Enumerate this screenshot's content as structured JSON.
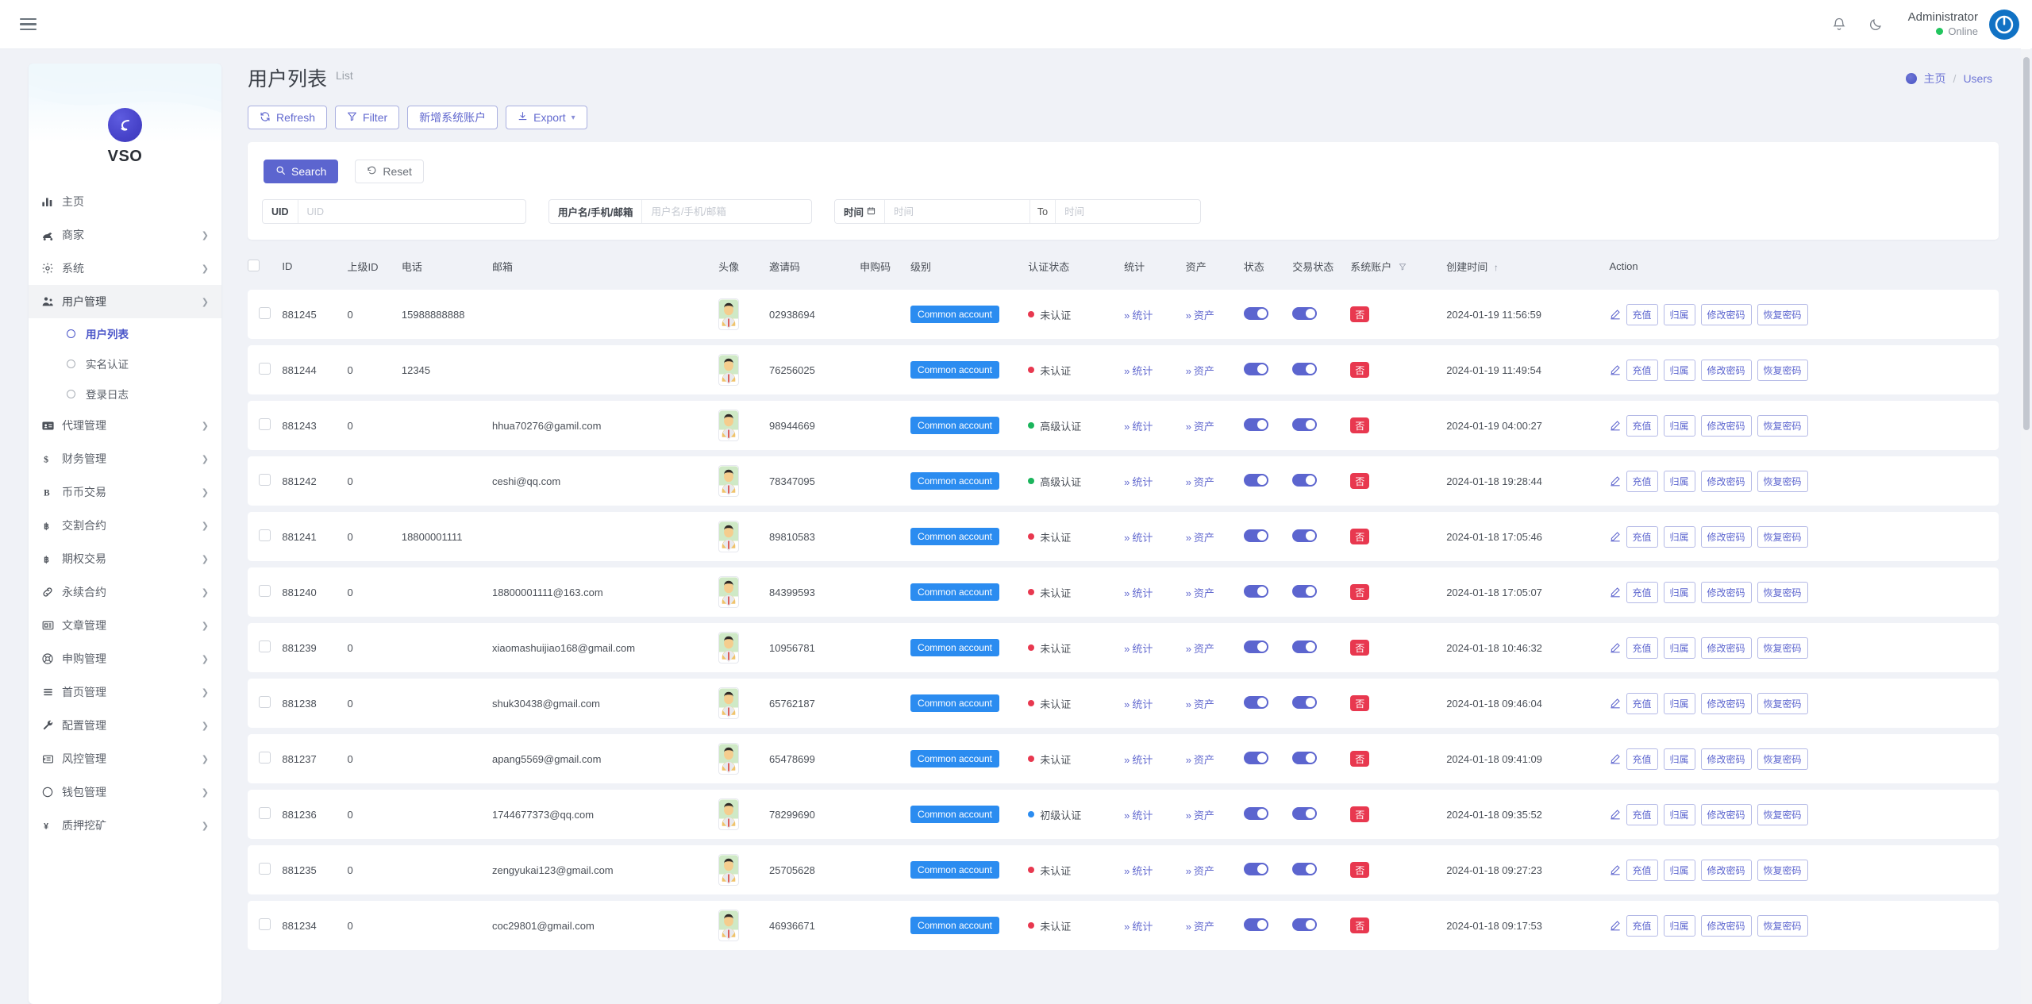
{
  "topbar": {
    "menu_icon": "hamburger-icon",
    "bell_icon": "bell-icon",
    "moon_icon": "moon-icon",
    "user_name": "Administrator",
    "user_status": "Online",
    "avatar_icon": "power-avatar-icon"
  },
  "sidebar": {
    "brand": "VSO",
    "items": [
      {
        "label": "主页",
        "icon": "bar-chart-icon",
        "expandable": false,
        "active": false
      },
      {
        "label": "商家",
        "icon": "merchant-icon",
        "expandable": true,
        "active": false
      },
      {
        "label": "系统",
        "icon": "gear-icon",
        "expandable": true,
        "active": false
      },
      {
        "label": "用户管理",
        "icon": "users-icon",
        "expandable": true,
        "active": true,
        "children": [
          {
            "label": "用户列表",
            "selected": true
          },
          {
            "label": "实名认证",
            "selected": false
          },
          {
            "label": "登录日志",
            "selected": false
          }
        ]
      },
      {
        "label": "代理管理",
        "icon": "id-card-icon",
        "expandable": true,
        "active": false
      },
      {
        "label": "财务管理",
        "icon": "dollar-icon",
        "expandable": true,
        "active": false
      },
      {
        "label": "币币交易",
        "icon": "b-icon",
        "expandable": true,
        "active": false
      },
      {
        "label": "交割合约",
        "icon": "bitcoin-icon",
        "expandable": true,
        "active": false
      },
      {
        "label": "期权交易",
        "icon": "bitcoin-icon",
        "expandable": true,
        "active": false
      },
      {
        "label": "永续合约",
        "icon": "link-icon",
        "expandable": true,
        "active": false
      },
      {
        "label": "文章管理",
        "icon": "newspaper-icon",
        "expandable": true,
        "active": false
      },
      {
        "label": "申购管理",
        "icon": "lifebuoy-icon",
        "expandable": true,
        "active": false
      },
      {
        "label": "首页管理",
        "icon": "list-icon",
        "expandable": true,
        "active": false
      },
      {
        "label": "配置管理",
        "icon": "wrench-icon",
        "expandable": true,
        "active": false
      },
      {
        "label": "风控管理",
        "icon": "indent-icon",
        "expandable": true,
        "active": false
      },
      {
        "label": "钱包管理",
        "icon": "circle-icon",
        "expandable": true,
        "active": false
      },
      {
        "label": "质押挖矿",
        "icon": "yen-icon",
        "expandable": true,
        "active": false
      }
    ]
  },
  "page": {
    "title": "用户列表",
    "subtitle": "List",
    "breadcrumb_home": "主页",
    "breadcrumb_sep": "/",
    "breadcrumb_current": "Users"
  },
  "toolbar": {
    "refresh_label": "Refresh",
    "filter_label": "Filter",
    "add_system_account_label": "新增系统账户",
    "export_label": "Export"
  },
  "search": {
    "search_label": "Search",
    "reset_label": "Reset",
    "uid_label": "UID",
    "uid_placeholder": "UID",
    "uid_value": "",
    "user_label": "用户名/手机/邮箱",
    "user_placeholder": "用户名/手机/邮箱",
    "user_value": "",
    "time_label": "时间",
    "time_from_placeholder": "时间",
    "time_from_value": "",
    "to_label": "To",
    "time_to_placeholder": "时间",
    "time_to_value": ""
  },
  "table": {
    "columns": [
      "ID",
      "上级ID",
      "电话",
      "邮箱",
      "头像",
      "邀请码",
      "申购码",
      "级别",
      "认证状态",
      "统计",
      "资产",
      "状态",
      "交易状态",
      "系统账户",
      "创建时间",
      "Action"
    ],
    "sort_column": "创建时间",
    "sort_dir": "↑",
    "filter_column": "系统账户",
    "links": {
      "stats": "统计",
      "assets": "资产"
    },
    "actions": {
      "edit_icon": "pencil-icon",
      "recharge": "充值",
      "attribution": "归属",
      "change_password": "修改密码",
      "restore_password": "恢复密码"
    },
    "system_account_no": "否",
    "level_tag": "Common account",
    "cert_colors": {
      "未认证": "#e8384f",
      "初级认证": "#2b8cf0",
      "高级认证": "#1bb55c"
    },
    "rows": [
      {
        "id": "881245",
        "parent_id": "0",
        "phone": "15988888888",
        "email": "",
        "invite": "02938694",
        "purchase": "",
        "level": "Common account",
        "cert": "未认证",
        "status_on": true,
        "trade_on": true,
        "system": "否",
        "created": "2024-01-19 11:56:59"
      },
      {
        "id": "881244",
        "parent_id": "0",
        "phone": "12345",
        "email": "",
        "invite": "76256025",
        "purchase": "",
        "level": "Common account",
        "cert": "未认证",
        "status_on": true,
        "trade_on": true,
        "system": "否",
        "created": "2024-01-19 11:49:54"
      },
      {
        "id": "881243",
        "parent_id": "0",
        "phone": "",
        "email": "hhua70276@gamil.com",
        "invite": "98944669",
        "purchase": "",
        "level": "Common account",
        "cert": "高级认证",
        "status_on": true,
        "trade_on": true,
        "system": "否",
        "created": "2024-01-19 04:00:27"
      },
      {
        "id": "881242",
        "parent_id": "0",
        "phone": "",
        "email": "ceshi@qq.com",
        "invite": "78347095",
        "purchase": "",
        "level": "Common account",
        "cert": "高级认证",
        "status_on": true,
        "trade_on": true,
        "system": "否",
        "created": "2024-01-18 19:28:44"
      },
      {
        "id": "881241",
        "parent_id": "0",
        "phone": "18800001111",
        "email": "",
        "invite": "89810583",
        "purchase": "",
        "level": "Common account",
        "cert": "未认证",
        "status_on": true,
        "trade_on": true,
        "system": "否",
        "created": "2024-01-18 17:05:46"
      },
      {
        "id": "881240",
        "parent_id": "0",
        "phone": "",
        "email": "18800001111@163.com",
        "invite": "84399593",
        "purchase": "",
        "level": "Common account",
        "cert": "未认证",
        "status_on": true,
        "trade_on": true,
        "system": "否",
        "created": "2024-01-18 17:05:07"
      },
      {
        "id": "881239",
        "parent_id": "0",
        "phone": "",
        "email": "xiaomashuijiao168@gmail.com",
        "invite": "10956781",
        "purchase": "",
        "level": "Common account",
        "cert": "未认证",
        "status_on": true,
        "trade_on": true,
        "system": "否",
        "created": "2024-01-18 10:46:32"
      },
      {
        "id": "881238",
        "parent_id": "0",
        "phone": "",
        "email": "shuk30438@gmail.com",
        "invite": "65762187",
        "purchase": "",
        "level": "Common account",
        "cert": "未认证",
        "status_on": true,
        "trade_on": true,
        "system": "否",
        "created": "2024-01-18 09:46:04"
      },
      {
        "id": "881237",
        "parent_id": "0",
        "phone": "",
        "email": "apang5569@gmail.com",
        "invite": "65478699",
        "purchase": "",
        "level": "Common account",
        "cert": "未认证",
        "status_on": true,
        "trade_on": true,
        "system": "否",
        "created": "2024-01-18 09:41:09"
      },
      {
        "id": "881236",
        "parent_id": "0",
        "phone": "",
        "email": "1744677373@qq.com",
        "invite": "78299690",
        "purchase": "",
        "level": "Common account",
        "cert": "初级认证",
        "status_on": true,
        "trade_on": true,
        "system": "否",
        "created": "2024-01-18 09:35:52"
      },
      {
        "id": "881235",
        "parent_id": "0",
        "phone": "",
        "email": "zengyukai123@gmail.com",
        "invite": "25705628",
        "purchase": "",
        "level": "Common account",
        "cert": "未认证",
        "status_on": true,
        "trade_on": true,
        "system": "否",
        "created": "2024-01-18 09:27:23"
      },
      {
        "id": "881234",
        "parent_id": "0",
        "phone": "",
        "email": "coc29801@gmail.com",
        "invite": "46936671",
        "purchase": "",
        "level": "Common account",
        "cert": "未认证",
        "status_on": true,
        "trade_on": true,
        "system": "否",
        "created": "2024-01-18 09:17:53"
      }
    ]
  },
  "colors": {
    "accent": "#5c65cf",
    "link": "#6269cf",
    "tag_blue": "#2b8cf0",
    "danger": "#e8384f",
    "success": "#1bb55c",
    "page_bg": "#f0f2f7"
  }
}
